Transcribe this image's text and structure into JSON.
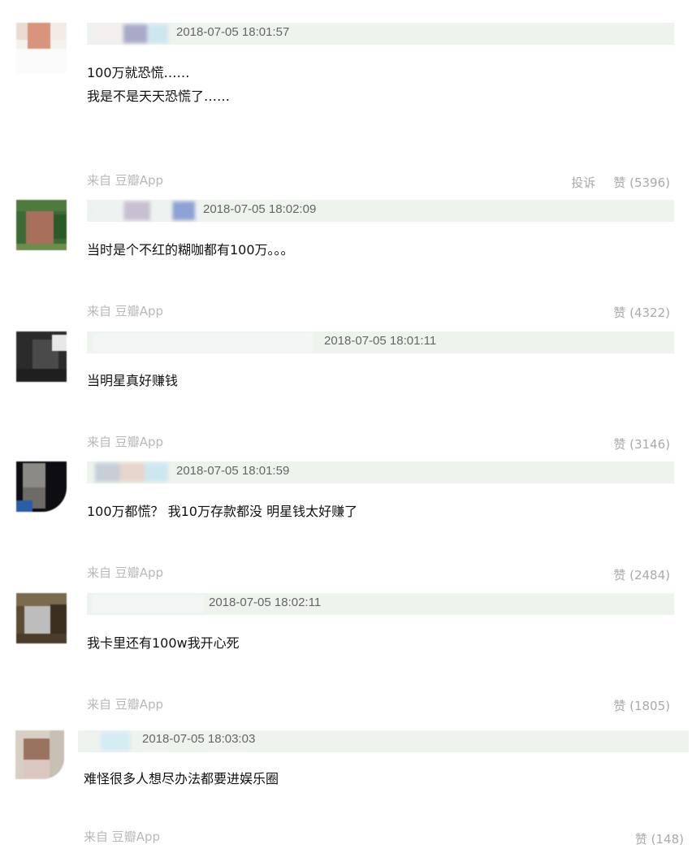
{
  "comments": [
    {
      "timestamp": "2018-07-05 18:01:57",
      "lines": [
        "100万就恐慌……",
        "我是不是天天恐慌了……"
      ],
      "source": "来自 豆瓣App",
      "report_label": "投诉",
      "like_label": "赞",
      "like_count": "(5396)"
    },
    {
      "timestamp": "2018-07-05 18:02:09",
      "lines": [
        "当时是个不红的糊咖都有100万。。。"
      ],
      "source": "来自 豆瓣App",
      "like_label": "赞",
      "like_count": "(4322)"
    },
    {
      "timestamp": "2018-07-05 18:01:11",
      "lines": [
        "当明星真好赚钱"
      ],
      "source": "来自 豆瓣App",
      "like_label": "赞",
      "like_count": "(3146)"
    },
    {
      "timestamp": "2018-07-05 18:01:59",
      "lines": [
        "100万都慌？ 我10万存款都没 明星钱太好赚了"
      ],
      "source": "来自 豆瓣App",
      "like_label": "赞",
      "like_count": "(2484)"
    },
    {
      "timestamp": "2018-07-05 18:02:11",
      "lines": [
        "我卡里还有100w我开心死"
      ],
      "source": "来自 豆瓣App",
      "like_label": "赞",
      "like_count": "(1805)"
    },
    {
      "timestamp": "2018-07-05 18:03:03",
      "lines": [
        "难怪很多人想尽办法都要进娱乐圈"
      ],
      "source": "来自 豆瓣App",
      "like_label": "赞",
      "like_count": "(148)"
    }
  ]
}
